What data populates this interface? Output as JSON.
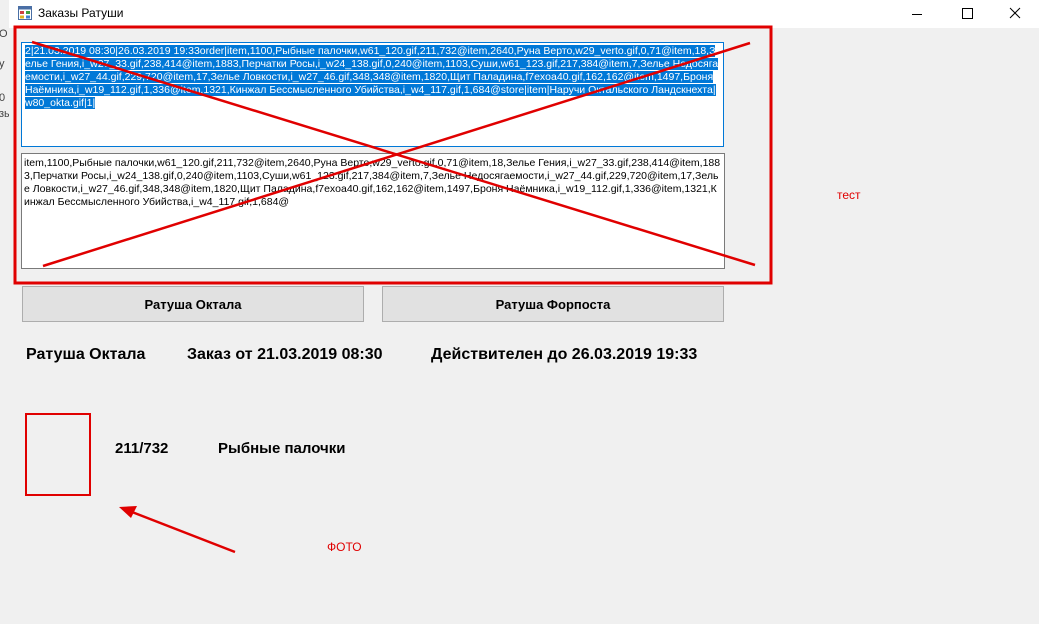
{
  "background_window": {
    "fragments": [
      "O",
      "y",
      "0",
      "зы"
    ]
  },
  "window": {
    "title": "Заказы Ратуши",
    "icon": "app-window-icon",
    "controls": {
      "minimize_icon": "minimize-icon",
      "maximize_icon": "maximize-icon",
      "close_icon": "close-icon"
    }
  },
  "raw_textbox": {
    "value": "2|21.03.2019 08:30|26.03.2019 19:33order|item,1100,Рыбные палочки,w61_120.gif,211,732@item,2640,Руна Верто,w29_verto.gif,0,71@item,18,Зелье Гения,i_w27_33.gif,238,414@item,1883,Перчатки Росы,i_w24_138.gif,0,240@item,1103,Суши,w61_123.gif,217,384@item,7,Зелье Недосягаемости,i_w27_44.gif,229,720@item,17,Зелье Ловкости,i_w27_46.gif,348,348@item,1820,Щит Паладина,f7exoa40.gif,162,162@item,1497,Броня Наёмника,i_w19_112.gif,1,336@item,1321,Кинжал Бессмысленного Убийства,i_w4_117.gif,1,684@store|item|Наручи Октальского Ландскнехта|w80_okta.gif|1|"
  },
  "parsed_textbox": {
    "value": "item,1100,Рыбные палочки,w61_120.gif,211,732@item,2640,Руна Верто,w29_verto.gif,0,71@item,18,Зелье Гения,i_w27_33.gif,238,414@item,1883,Перчатки Росы,i_w24_138.gif,0,240@item,1103,Суши,w61_123.gif,217,384@item,7,Зелье Недосягаемости,i_w27_44.gif,229,720@item,17,Зелье Ловкости,i_w27_46.gif,348,348@item,1820,Щит Паладина,f7exoa40.gif,162,162@item,1497,Броня Наёмника,i_w19_112.gif,1,336@item,1321,Кинжал Бессмысленного Убийства,i_w4_117.gif,1,684@"
  },
  "buttons": {
    "oktal": "Ратуша Октала",
    "forpost": "Ратуша Форпоста"
  },
  "info": {
    "town_name": "Ратуша Октала",
    "order_date": "Заказ от 21.03.2019 08:30",
    "valid_until": "Действителен до 26.03.2019 19:33"
  },
  "item": {
    "count": "211/732",
    "name": "Рыбные палочки"
  },
  "annotations": {
    "test_label": "тест",
    "photo_label": "ФОТО",
    "color": "#e00000"
  },
  "colors": {
    "selection": "#0078d7",
    "window_bg": "#f0f0f0",
    "button_bg": "#e1e1e1"
  }
}
